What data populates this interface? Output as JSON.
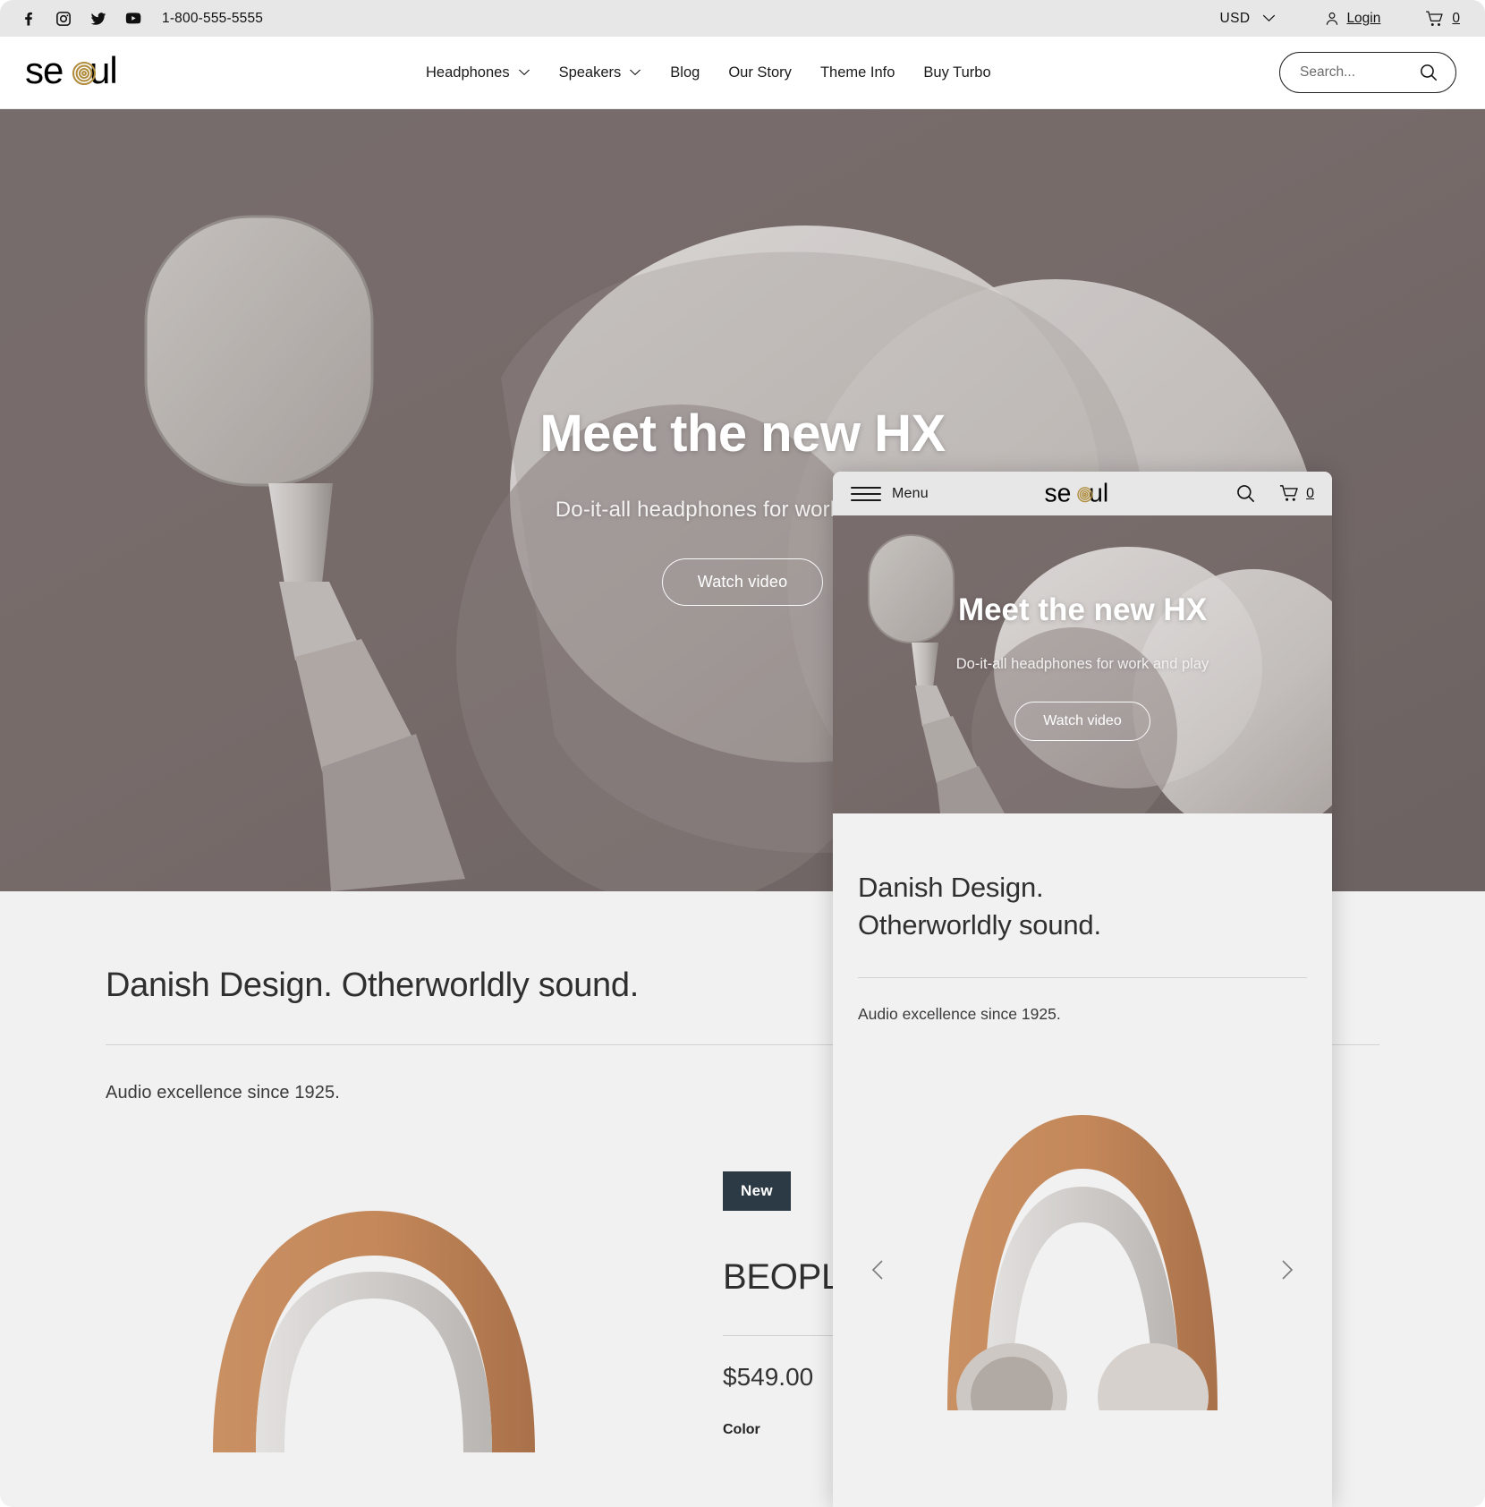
{
  "announcement": {
    "phone": "1-800-555-5555",
    "social": [
      "facebook-icon",
      "instagram-icon",
      "twitter-icon",
      "youtube-icon"
    ],
    "currency": "USD",
    "login_label": "Login",
    "cart_count": "0"
  },
  "header": {
    "logo_text": "seoul",
    "nav": [
      {
        "label": "Headphones",
        "has_dropdown": true
      },
      {
        "label": "Speakers",
        "has_dropdown": true
      },
      {
        "label": "Blog",
        "has_dropdown": false
      },
      {
        "label": "Our Story",
        "has_dropdown": false
      },
      {
        "label": "Theme Info",
        "has_dropdown": false
      },
      {
        "label": "Buy Turbo",
        "has_dropdown": false
      }
    ],
    "search_placeholder": "Search...",
    "search_value": ""
  },
  "hero": {
    "title": "Meet the new HX",
    "subtitle": "Do-it-all headphones for work and play",
    "button": "Watch video"
  },
  "section": {
    "title": "Danish Design. Otherworldly sound.",
    "subtitle": "Audio excellence since 1925."
  },
  "product": {
    "badge": "New",
    "name": "BEOPLAY",
    "name_visible": "BEOPL",
    "price": "$549.00",
    "color_label": "Color"
  },
  "mobile": {
    "menu_label": "Menu",
    "logo_text": "seoul",
    "cart_count": "0",
    "hero": {
      "title": "Meet the new HX",
      "subtitle": "Do-it-all headphones for work and play",
      "button": "Watch video"
    },
    "section": {
      "title_line1": "Danish Design.",
      "title_line2": "Otherworldly sound.",
      "subtitle": "Audio excellence since 1925."
    }
  },
  "colors": {
    "accent_gold": "#b08d3f",
    "badge_bg": "#2b3a45",
    "announce_bg": "#e7e7e7",
    "section_bg": "#f1f1f1",
    "hero_bg": "#7a6f6e"
  }
}
